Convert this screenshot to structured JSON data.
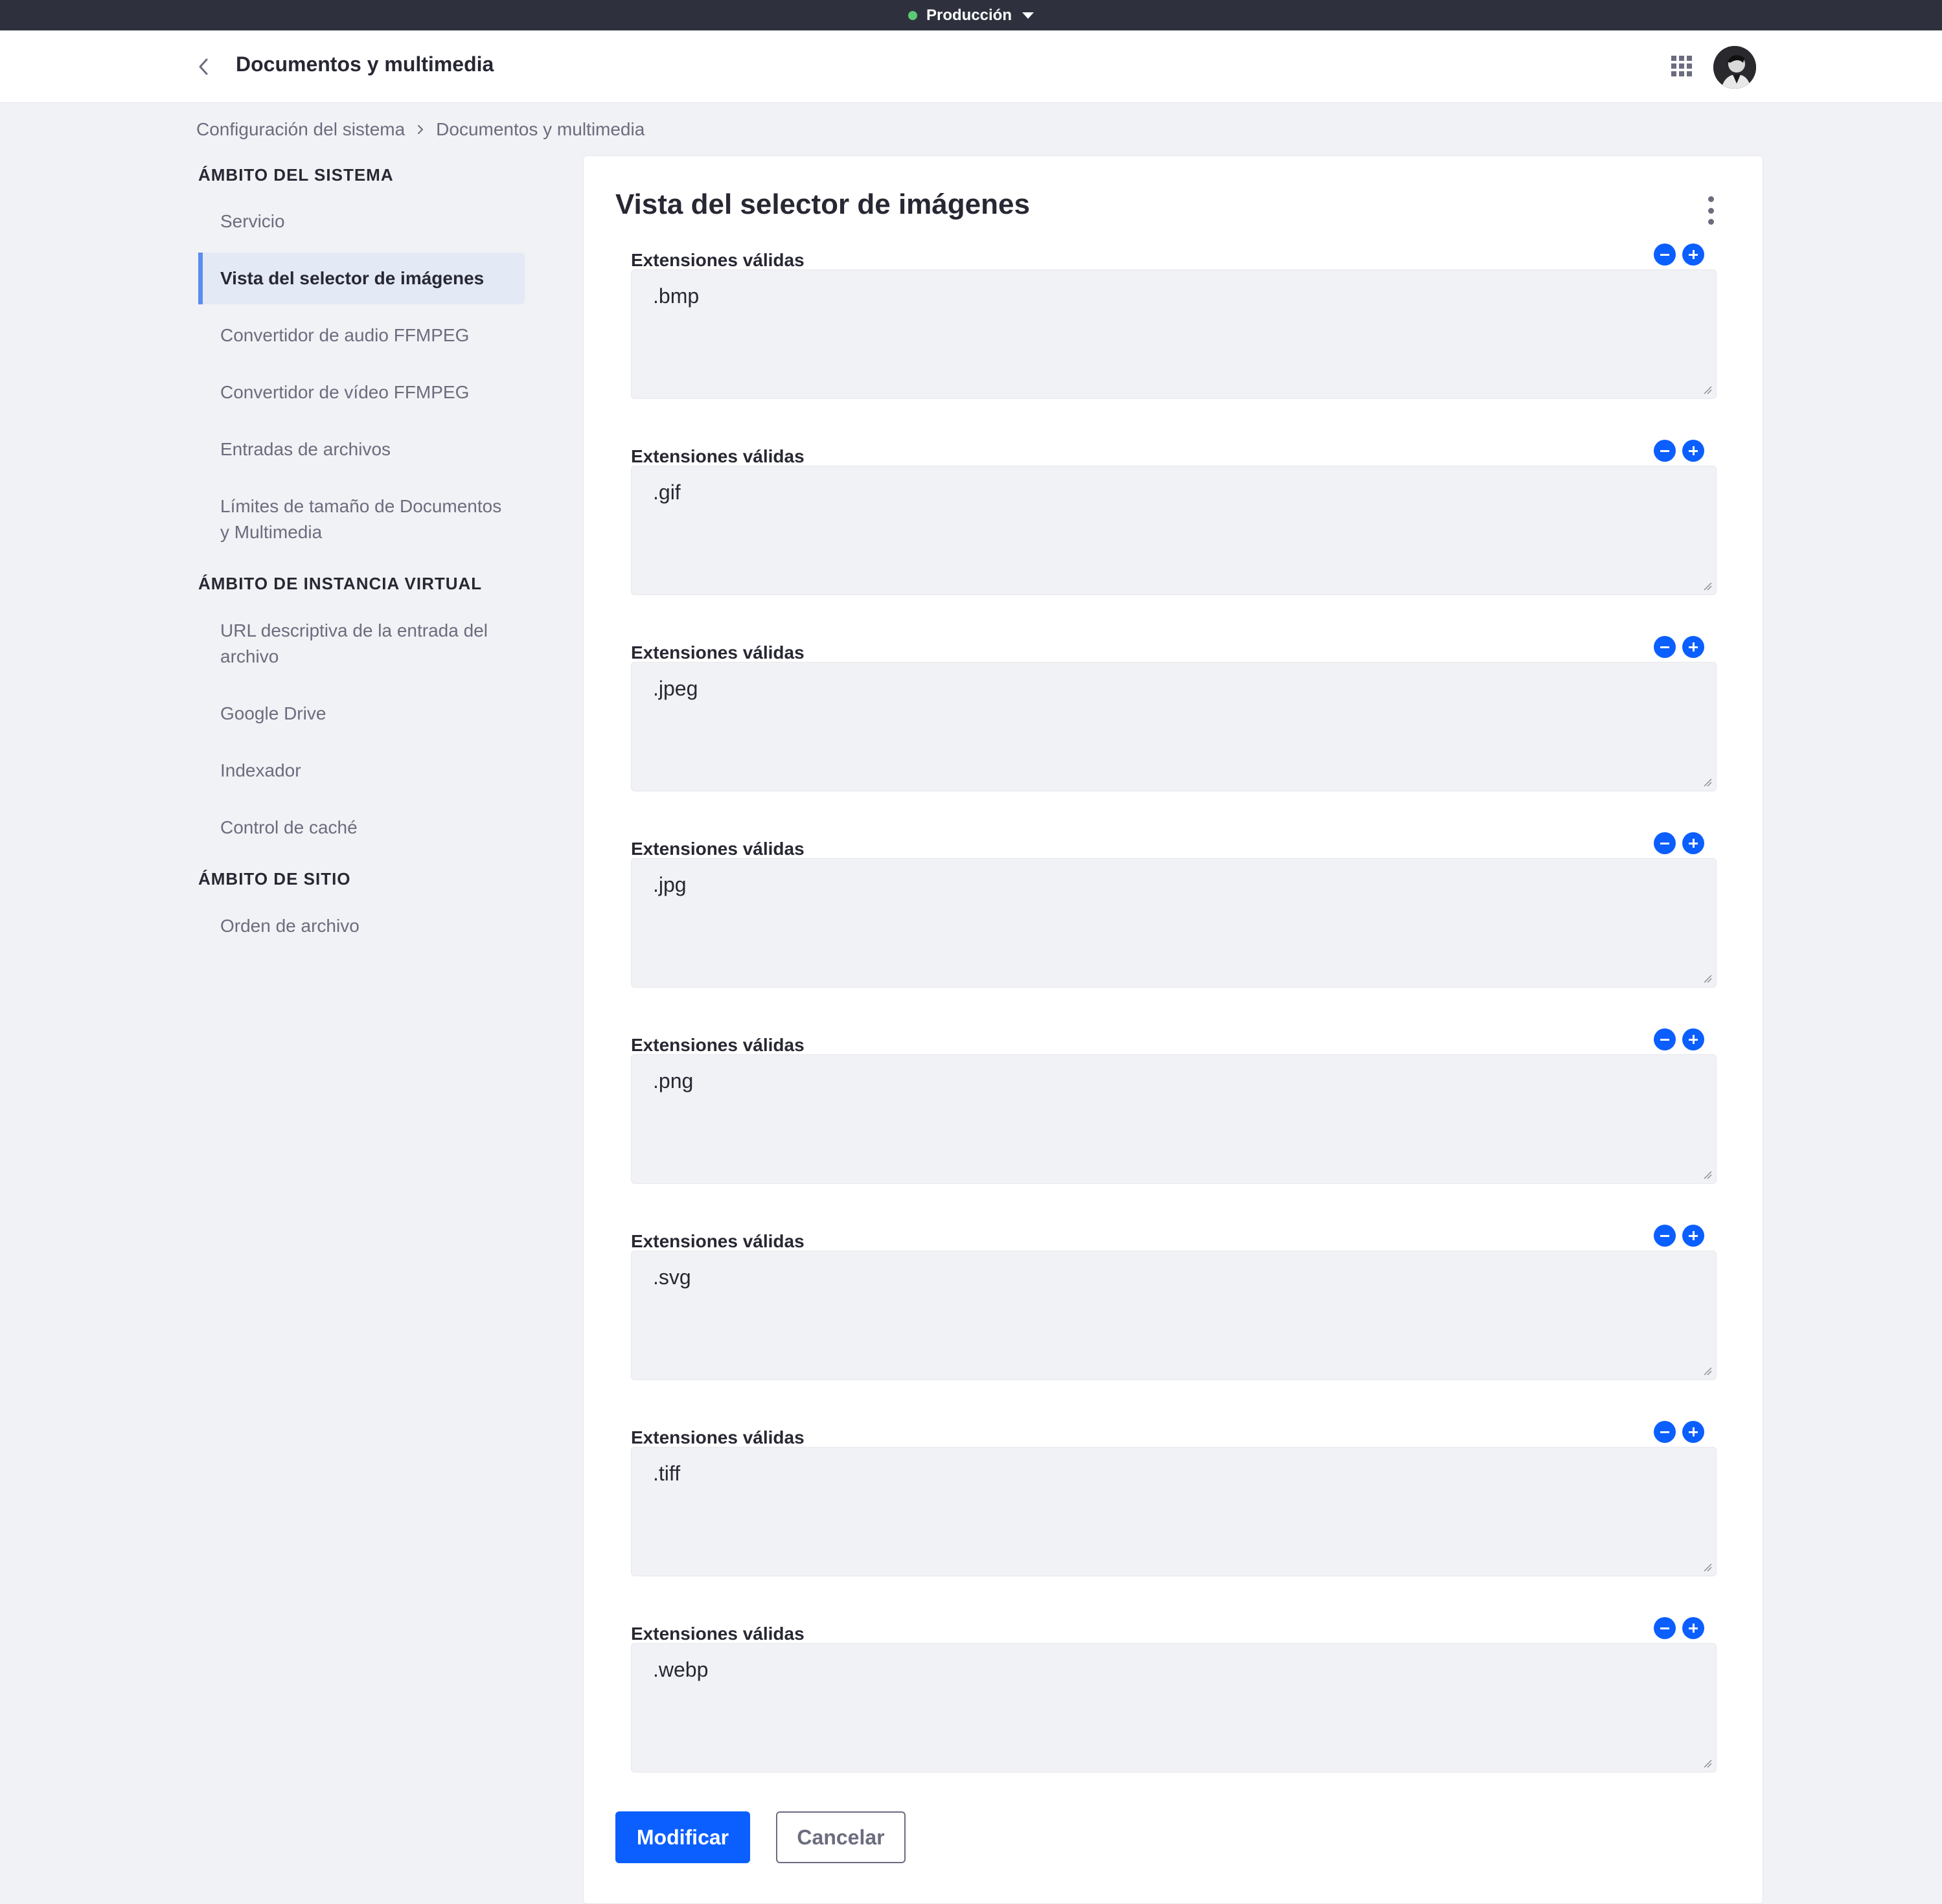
{
  "environment": {
    "label": "Producción"
  },
  "header": {
    "title": "Documentos y multimedia"
  },
  "breadcrumb": {
    "items": [
      "Configuración del sistema",
      "Documentos y multimedia"
    ]
  },
  "sidebar": {
    "sections": [
      {
        "heading": "ÁMBITO DEL SISTEMA",
        "items": [
          "Servicio",
          "Vista del selector de imágenes",
          "Convertidor de audio FFMPEG",
          "Convertidor de vídeo FFMPEG",
          "Entradas de archivos",
          "Límites de tamaño de Documentos y Multimedia"
        ]
      },
      {
        "heading": "ÁMBITO DE INSTANCIA VIRTUAL",
        "items": [
          "URL descriptiva de la entrada del archivo",
          "Google Drive",
          "Indexador",
          "Control de caché"
        ]
      },
      {
        "heading": "ÁMBITO DE SITIO",
        "items": [
          "Orden de archivo"
        ]
      }
    ],
    "active_item": "Vista del selector de imágenes"
  },
  "form": {
    "title": "Vista del selector de imágenes",
    "field_label": "Extensiones válidas",
    "values": [
      ".bmp",
      ".gif",
      ".jpeg",
      ".jpg",
      ".png",
      ".svg",
      ".tiff",
      ".webp"
    ],
    "submit_label": "Modificar",
    "cancel_label": "Cancelar"
  },
  "colors": {
    "primary": "#0b5fff",
    "env_bar": "#2e313d",
    "env_dot": "#5aca75",
    "active_border": "#5b8def"
  }
}
